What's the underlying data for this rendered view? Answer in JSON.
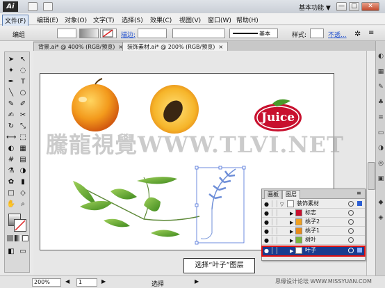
{
  "titlebar": {
    "logo": "Ai",
    "workspace": "基本功能",
    "workspace_arrow": "▼",
    "minimize": "—",
    "maximize": "□",
    "close": "✕"
  },
  "menu": [
    "文件(F)",
    "编辑(E)",
    "对象(O)",
    "文字(T)",
    "选择(S)",
    "效果(C)",
    "视图(V)",
    "窗口(W)",
    "帮助(H)"
  ],
  "control": {
    "group_label": "编组",
    "stroke_label": "描边:",
    "stroke_value": "",
    "style_label": "样式:",
    "basic_label": "基本",
    "opacity_label": "不透..."
  },
  "tabs": [
    {
      "label": "背景.ai* @ 400% (RGB/预览)",
      "close": "×"
    },
    {
      "label": "装饰素材.ai* @ 200% (RGB/预览)",
      "close": "×"
    }
  ],
  "canvas": {
    "watermark": "騰龍視覺WWW.TLVI.NET",
    "juice_text": "Juice"
  },
  "layers": {
    "tabs": [
      "画板",
      "图层"
    ],
    "rows": [
      {
        "name": "装饰素材",
        "level": 0,
        "expanded": true
      },
      {
        "name": "标志",
        "level": 1
      },
      {
        "name": "桃子2",
        "level": 1
      },
      {
        "name": "桃子1",
        "level": 1
      },
      {
        "name": "树叶",
        "level": 1
      },
      {
        "name": "叶子",
        "level": 1,
        "selected": true
      }
    ],
    "eye": "●",
    "tri": "▶",
    "tri_open": "▽"
  },
  "caption": "选择“叶子”图层",
  "status": {
    "zoom": "200%",
    "page": "1",
    "mode": "选择"
  },
  "site": "思缘设计论坛 WWW.MISSYUAN.COM",
  "colors": {
    "accent": "#1a3c8f",
    "highlight": "#d11111",
    "juice_red": "#c8102e",
    "peach": "#f0a020",
    "leaf_green": "#5a9a2a"
  }
}
